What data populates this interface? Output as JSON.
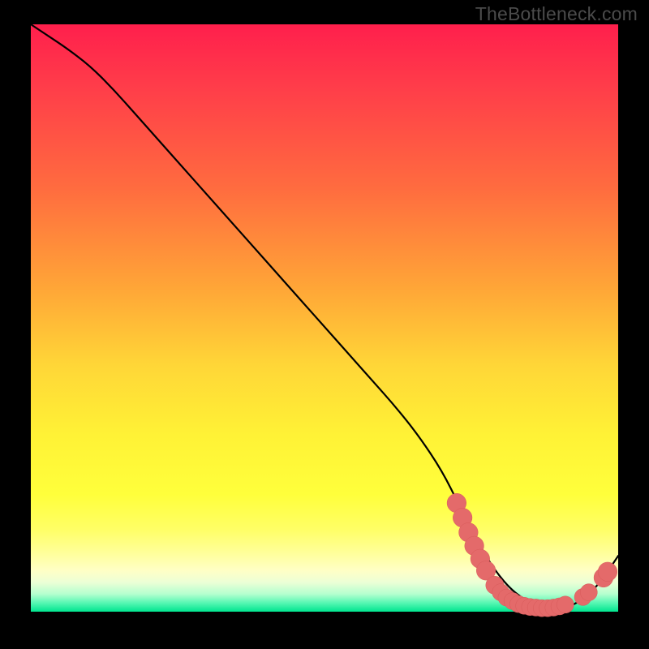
{
  "watermark": "TheBottleneck.com",
  "colors": {
    "background": "#000000",
    "curve": "#000000",
    "marker_fill": "#e46a6a",
    "marker_stroke": "#d85a5a"
  },
  "chart_data": {
    "type": "line",
    "title": "",
    "xlabel": "",
    "ylabel": "",
    "xlim": [
      0,
      100
    ],
    "ylim": [
      0,
      100
    ],
    "grid": false,
    "legend": false,
    "series": [
      {
        "name": "curve",
        "x": [
          0,
          3,
          6,
          10,
          14,
          18,
          22,
          26,
          30,
          34,
          38,
          42,
          46,
          50,
          54,
          58,
          62,
          66,
          70,
          73,
          76,
          79,
          82,
          85,
          88,
          91,
          94,
          97,
          100
        ],
        "y": [
          100,
          98,
          96,
          93,
          89,
          84.5,
          80,
          75.5,
          71,
          66.5,
          62,
          57.5,
          53,
          48.5,
          44,
          39.5,
          35,
          30,
          24,
          18,
          12,
          7,
          3.5,
          1.5,
          0.6,
          0.6,
          2.0,
          5.0,
          9.5
        ]
      }
    ],
    "markers": [
      {
        "x": 72.5,
        "y": 18.5,
        "r": 1.2
      },
      {
        "x": 73.5,
        "y": 16.0,
        "r": 1.2
      },
      {
        "x": 74.5,
        "y": 13.5,
        "r": 1.2
      },
      {
        "x": 75.5,
        "y": 11.2,
        "r": 1.2
      },
      {
        "x": 76.5,
        "y": 9.0,
        "r": 1.2
      },
      {
        "x": 77.5,
        "y": 7.0,
        "r": 1.2
      },
      {
        "x": 79.0,
        "y": 4.5,
        "r": 1.1
      },
      {
        "x": 80.0,
        "y": 3.3,
        "r": 1.0
      },
      {
        "x": 81.0,
        "y": 2.4,
        "r": 1.0
      },
      {
        "x": 82.0,
        "y": 1.8,
        "r": 1.0
      },
      {
        "x": 83.0,
        "y": 1.3,
        "r": 1.0
      },
      {
        "x": 84.0,
        "y": 1.0,
        "r": 1.0
      },
      {
        "x": 85.0,
        "y": 0.8,
        "r": 1.0
      },
      {
        "x": 86.0,
        "y": 0.7,
        "r": 1.0
      },
      {
        "x": 87.0,
        "y": 0.6,
        "r": 1.0
      },
      {
        "x": 88.0,
        "y": 0.6,
        "r": 1.0
      },
      {
        "x": 89.0,
        "y": 0.7,
        "r": 1.0
      },
      {
        "x": 90.0,
        "y": 0.9,
        "r": 1.0
      },
      {
        "x": 91.0,
        "y": 1.2,
        "r": 1.0
      },
      {
        "x": 94.0,
        "y": 2.5,
        "r": 1.0
      },
      {
        "x": 95.0,
        "y": 3.3,
        "r": 1.0
      },
      {
        "x": 97.5,
        "y": 5.8,
        "r": 1.2
      },
      {
        "x": 98.2,
        "y": 6.8,
        "r": 1.2
      }
    ]
  }
}
